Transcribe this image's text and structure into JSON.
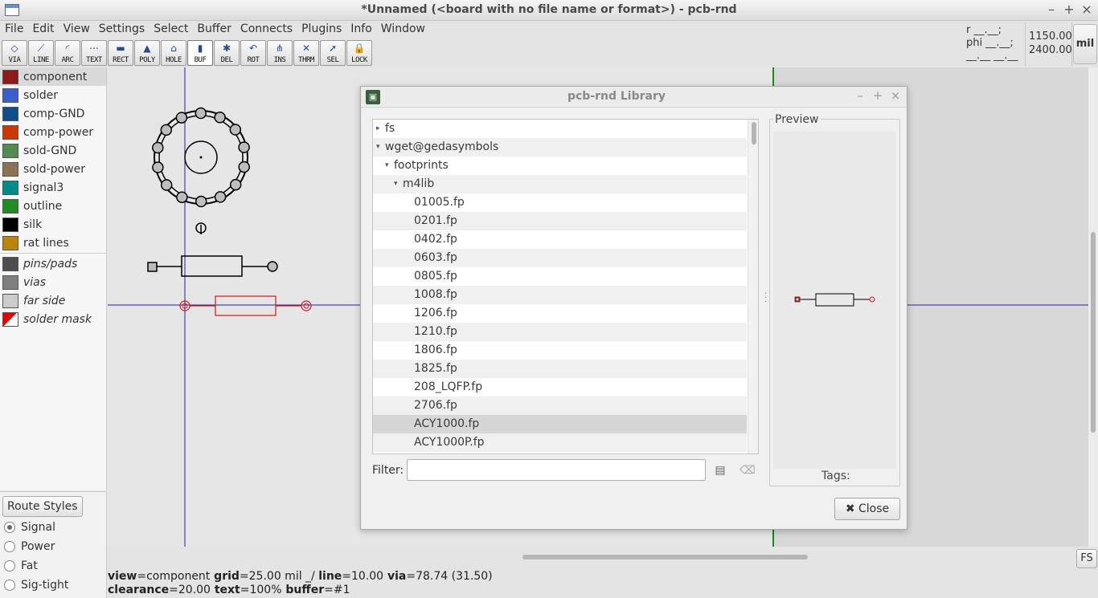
{
  "window": {
    "title": "*Unnamed (<board with no file name or format>) - pcb-rnd",
    "minimize": "–",
    "maximize": "+",
    "close": "×"
  },
  "menu": [
    "File",
    "Edit",
    "View",
    "Settings",
    "Select",
    "Buffer",
    "Connects",
    "Plugins",
    "Info",
    "Window"
  ],
  "tools": [
    {
      "label": "VIA",
      "icon": "via-icon",
      "glyph": "◇"
    },
    {
      "label": "LINE",
      "icon": "line-icon",
      "glyph": "⟋"
    },
    {
      "label": "ARC",
      "icon": "arc-icon",
      "glyph": "◜"
    },
    {
      "label": "TEXT",
      "icon": "text-icon",
      "glyph": "⋯"
    },
    {
      "label": "RECT",
      "icon": "rect-icon",
      "glyph": "▬"
    },
    {
      "label": "POLY",
      "icon": "poly-icon",
      "glyph": "▲"
    },
    {
      "label": "HOLE",
      "icon": "hole-icon",
      "glyph": "⌂"
    },
    {
      "label": "BUF",
      "icon": "buffer-icon",
      "glyph": "▮",
      "active": true
    },
    {
      "label": "DEL",
      "icon": "delete-icon",
      "glyph": "✱"
    },
    {
      "label": "ROT",
      "icon": "rotate-icon",
      "glyph": "↶"
    },
    {
      "label": "INS",
      "icon": "insert-icon",
      "glyph": "⋔"
    },
    {
      "label": "THRM",
      "icon": "thermal-icon",
      "glyph": "✕"
    },
    {
      "label": "SEL",
      "icon": "select-icon",
      "glyph": "➚"
    },
    {
      "label": "LOCK",
      "icon": "lock-icon",
      "glyph": "🔒"
    }
  ],
  "readout": {
    "r": "r __.__;",
    "phi": "phi __.__;",
    "blank": "__.__ __.__",
    "x": "1150.00",
    "y": "2400.00",
    "unit": "mil"
  },
  "layers": [
    {
      "name": "component",
      "color": "#8b1a1a",
      "selected": true
    },
    {
      "name": "solder",
      "color": "#3a5fcd"
    },
    {
      "name": "comp-GND",
      "color": "#104e8b"
    },
    {
      "name": "comp-power",
      "color": "#cd3700"
    },
    {
      "name": "sold-GND",
      "color": "#548b54"
    },
    {
      "name": "sold-power",
      "color": "#8b7355"
    },
    {
      "name": "signal3",
      "color": "#008b8b"
    },
    {
      "name": "outline",
      "color": "#228b22"
    },
    {
      "name": "silk",
      "color": "#000000"
    },
    {
      "name": "rat lines",
      "color": "#b8860b"
    }
  ],
  "virtual_layers": [
    {
      "name": "pins/pads",
      "color": "#4d4d4d"
    },
    {
      "name": "vias",
      "color": "#7f7f7f"
    },
    {
      "name": "far side",
      "color": "#cccccc"
    },
    {
      "name": "solder mask",
      "color": "split-red-white"
    }
  ],
  "route_styles": {
    "button": "Route Styles",
    "options": [
      {
        "name": "Signal",
        "selected": true
      },
      {
        "name": "Power"
      },
      {
        "name": "Fat"
      },
      {
        "name": "Sig-tight"
      }
    ]
  },
  "status": {
    "line1": [
      {
        "k": "view",
        "v": "=component"
      },
      {
        "k": " grid",
        "v": "=25.00 mil  _/  "
      },
      {
        "k": " line",
        "v": "=10.00"
      },
      {
        "k": " via",
        "v": "=78.74 (31.50)"
      }
    ],
    "line2": [
      {
        "k": "clearance",
        "v": "=20.00"
      },
      {
        "k": " text",
        "v": "=100%"
      },
      {
        "k": " buffer",
        "v": "=#1"
      }
    ]
  },
  "fs_button": "FS",
  "library": {
    "title": "pcb-rnd Library",
    "tree": [
      {
        "label": "fs",
        "depth": 0,
        "arrow": "right"
      },
      {
        "label": "wget@gedasymbols",
        "depth": 0,
        "arrow": "down"
      },
      {
        "label": "footprints",
        "depth": 1,
        "arrow": "down"
      },
      {
        "label": "m4lib",
        "depth": 2,
        "arrow": "down"
      },
      {
        "label": "01005.fp",
        "depth": 3
      },
      {
        "label": "0201.fp",
        "depth": 3
      },
      {
        "label": "0402.fp",
        "depth": 3
      },
      {
        "label": "0603.fp",
        "depth": 3
      },
      {
        "label": "0805.fp",
        "depth": 3
      },
      {
        "label": "1008.fp",
        "depth": 3
      },
      {
        "label": "1206.fp",
        "depth": 3
      },
      {
        "label": "1210.fp",
        "depth": 3
      },
      {
        "label": "1806.fp",
        "depth": 3
      },
      {
        "label": "1825.fp",
        "depth": 3
      },
      {
        "label": "208_LQFP.fp",
        "depth": 3
      },
      {
        "label": "2706.fp",
        "depth": 3
      },
      {
        "label": "ACY1000.fp",
        "depth": 3,
        "selected": true
      },
      {
        "label": "ACY1000P.fp",
        "depth": 3
      }
    ],
    "filter_label": "Filter:",
    "filter_value": "",
    "preview_label": "Preview",
    "tags_label": "Tags:",
    "close_label": "Close",
    "close_glyph": "✖"
  },
  "colors": {
    "crosshair": "#2020b0",
    "board_edge": "#1a8a1a",
    "selected_part": "#d01818",
    "silk": "#000000"
  }
}
